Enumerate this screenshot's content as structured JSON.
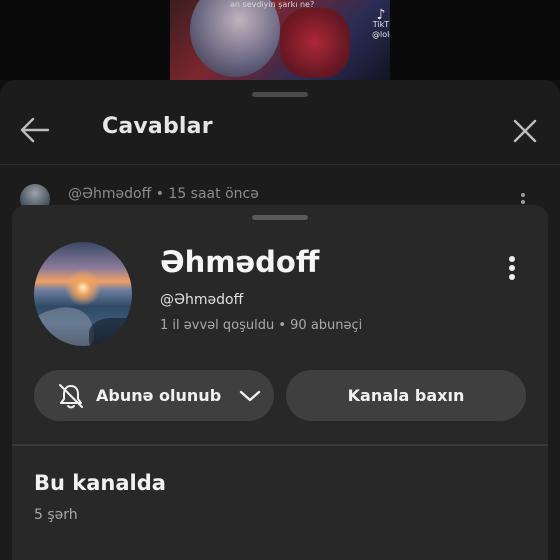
{
  "video": {
    "caption": "ən sevdiyin şarkı ne?",
    "watermark": "TikT",
    "watermark_sub": "@lolo"
  },
  "replies": {
    "title": "Cavablar",
    "comment_author": "@Əhmədoff",
    "comment_time": "15 saat öncə"
  },
  "channel": {
    "name": "Əhmədoff",
    "handle": "@Əhmədoff",
    "stats": "1 il əvvəl qoşuldu • 90 abunəçi",
    "subscribed_label": "Abunə olunub",
    "view_channel_label": "Kanala baxın",
    "section_title": "Bu kanalda",
    "section_sub": "5 şərh"
  },
  "icons": {
    "back": "arrow-left-icon",
    "close": "close-icon",
    "more": "more-vertical-icon",
    "bell": "bell-off-icon",
    "chevron": "chevron-down-icon"
  }
}
